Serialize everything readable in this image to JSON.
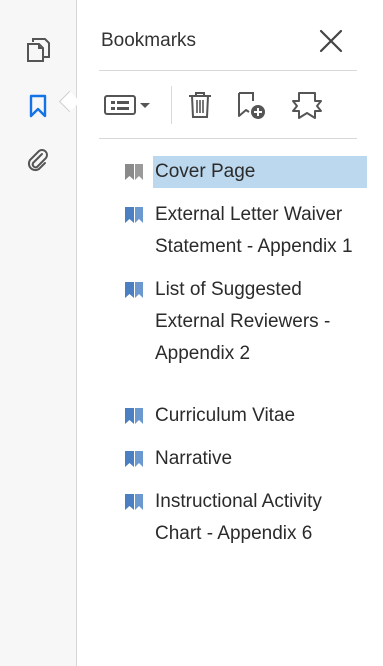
{
  "sidebar": {
    "tools": [
      {
        "name": "pages",
        "icon": "page-thumbnails-icon"
      },
      {
        "name": "bookmarks",
        "icon": "bookmark-icon",
        "active": true
      },
      {
        "name": "attachments",
        "icon": "paperclip-icon"
      }
    ],
    "accent_color": "#1473e6"
  },
  "panel": {
    "title": "Bookmarks",
    "toolbar": [
      {
        "icon": "options-menu-icon"
      },
      {
        "icon": "trash-icon"
      },
      {
        "icon": "new-bookmark-icon"
      },
      {
        "icon": "expand-bookmark-icon"
      }
    ],
    "selected_color": "#bcd8ee"
  },
  "bookmarks": [
    {
      "label": "Cover Page",
      "selected": true
    },
    {
      "label": "External Letter Waiver Statement - Appendix 1"
    },
    {
      "label": "List of Suggested External Reviewers - Appendix 2"
    },
    {
      "label": "Curriculum Vitae"
    },
    {
      "label": "Narrative"
    },
    {
      "label": "Instructional Activity Chart - Appendix 6"
    }
  ]
}
